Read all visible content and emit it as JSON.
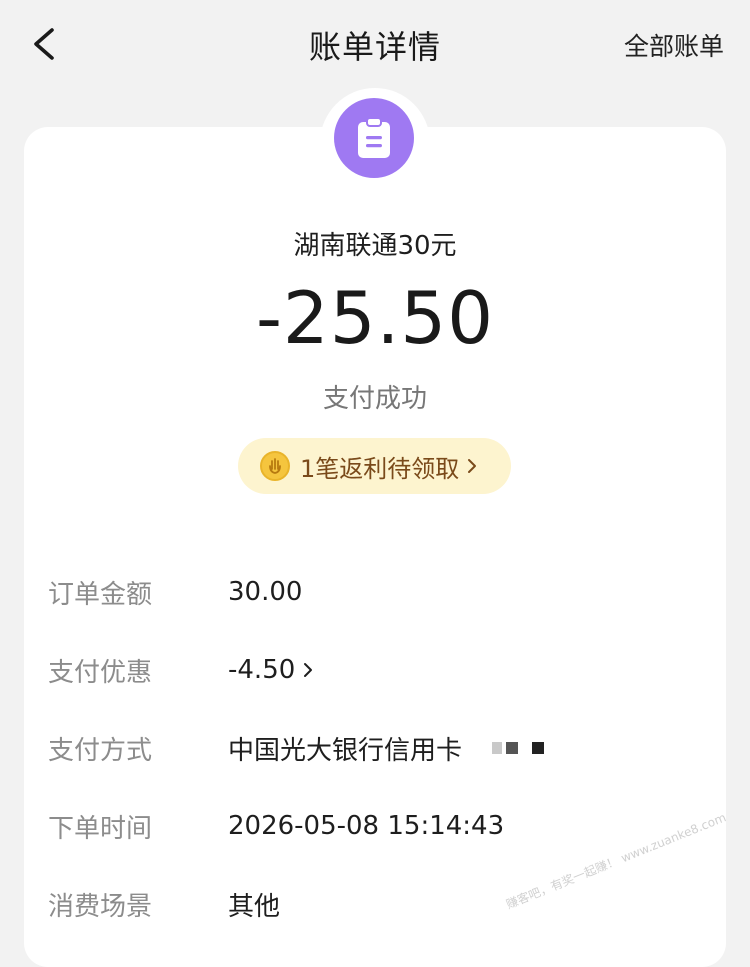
{
  "nav": {
    "title": "账单详情",
    "right_action": "全部账单",
    "back_icon": "back-arrow-icon"
  },
  "header": {
    "icon": "bill-icon",
    "icon_color": "#9f79f2",
    "merchant": "湖南联通30元",
    "amount": "-25.50",
    "status": "支付成功"
  },
  "rebate": {
    "label": "1笔返利待领取",
    "icon": "coin-icon",
    "bg_color": "#fdf4cf"
  },
  "details": [
    {
      "label": "订单金额",
      "value": "30.00"
    },
    {
      "label": "支付优惠",
      "value": "-4.50"
    },
    {
      "label": "支付方式",
      "value": "中国光大银行信用卡"
    },
    {
      "label": "下单时间",
      "value": "2026-05-08 15:14:43"
    },
    {
      "label": "消费场景",
      "value": "其他"
    }
  ],
  "watermark": "赚客吧，有奖一起赚！ www.zuanke8.com"
}
